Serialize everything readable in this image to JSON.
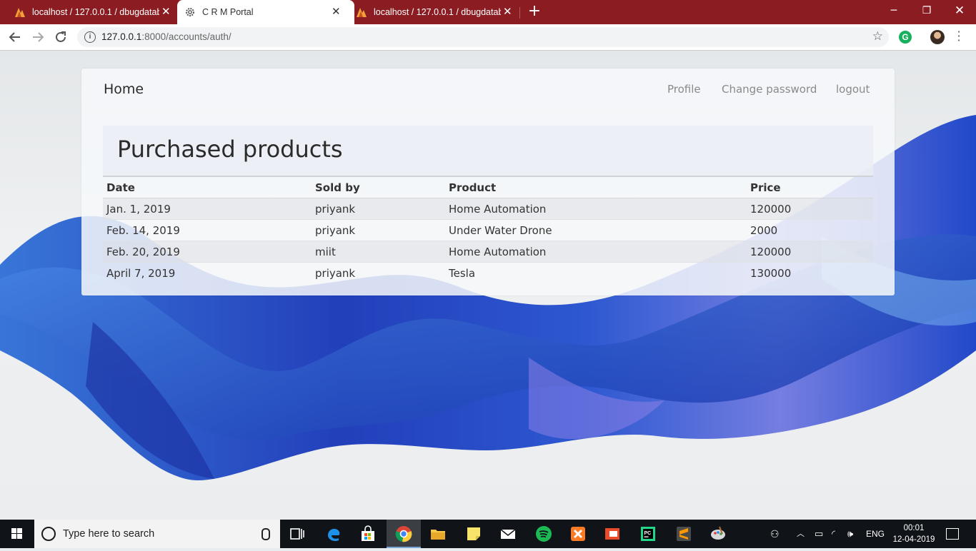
{
  "browser": {
    "tabs": [
      {
        "title": "localhost / 127.0.0.1 / dbugdatab",
        "icon": "phpmyadmin-icon",
        "active": false
      },
      {
        "title": "C R M Portal",
        "icon": "gear-icon",
        "active": true
      },
      {
        "title": "localhost / 127.0.0.1 / dbugdatab",
        "icon": "phpmyadmin-icon",
        "active": false
      }
    ],
    "new_tab_label": "+",
    "url_host": "127.0.0.1",
    "url_rest": ":8000/accounts/auth/",
    "grammarly_label": "G",
    "tab_close_glyph": "✕",
    "window_controls": {
      "minimize": "─",
      "maximize": "❐",
      "close": "✕"
    }
  },
  "navbar": {
    "brand": "Home",
    "links": [
      "Profile",
      "Change password",
      "logout"
    ]
  },
  "page": {
    "heading": "Purchased products",
    "table": {
      "columns": [
        "Date",
        "Sold by",
        "Product",
        "Price"
      ],
      "rows": [
        [
          "Jan. 1, 2019",
          "priyank",
          "Home Automation",
          "120000"
        ],
        [
          "Feb. 14, 2019",
          "priyank",
          "Under Water Drone",
          "2000"
        ],
        [
          "Feb. 20, 2019",
          "miit",
          "Home Automation",
          "120000"
        ],
        [
          "April 7, 2019",
          "priyank",
          "Tesla",
          "130000"
        ]
      ]
    }
  },
  "taskbar": {
    "search_placeholder": "Type here to search",
    "language": "ENG",
    "time": "00:01",
    "date": "12-04-2019"
  },
  "colors": {
    "tabstrip": "#8b1d22",
    "accent_blue": "#1f4fd0"
  }
}
